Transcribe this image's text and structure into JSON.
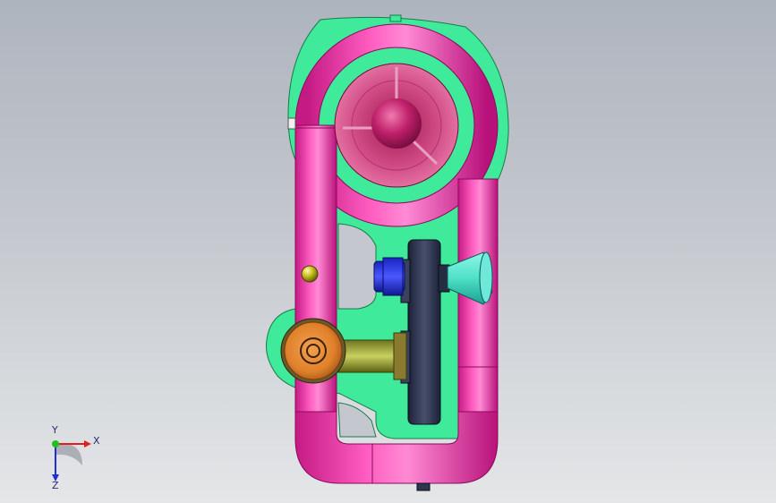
{
  "viewport": {
    "background_top": "#aeb4be",
    "background_bottom": "#e4e6e8"
  },
  "model": {
    "colors": {
      "frame": "#f23aa6",
      "frame_shadow": "#b8127a",
      "base_plate": "#3fea9a",
      "fan_housing": "#d94b8a",
      "hub": "#b0185a",
      "wheel": "#2e3550",
      "shaft_blue": "#2a36e8",
      "nozzle": "#4ee0c8",
      "bolt": "#c8c020",
      "flange": "#e8842a",
      "rod": "#a8b040"
    }
  },
  "triad": {
    "x_label": "X",
    "y_label": "Y",
    "z_label": "Z"
  }
}
